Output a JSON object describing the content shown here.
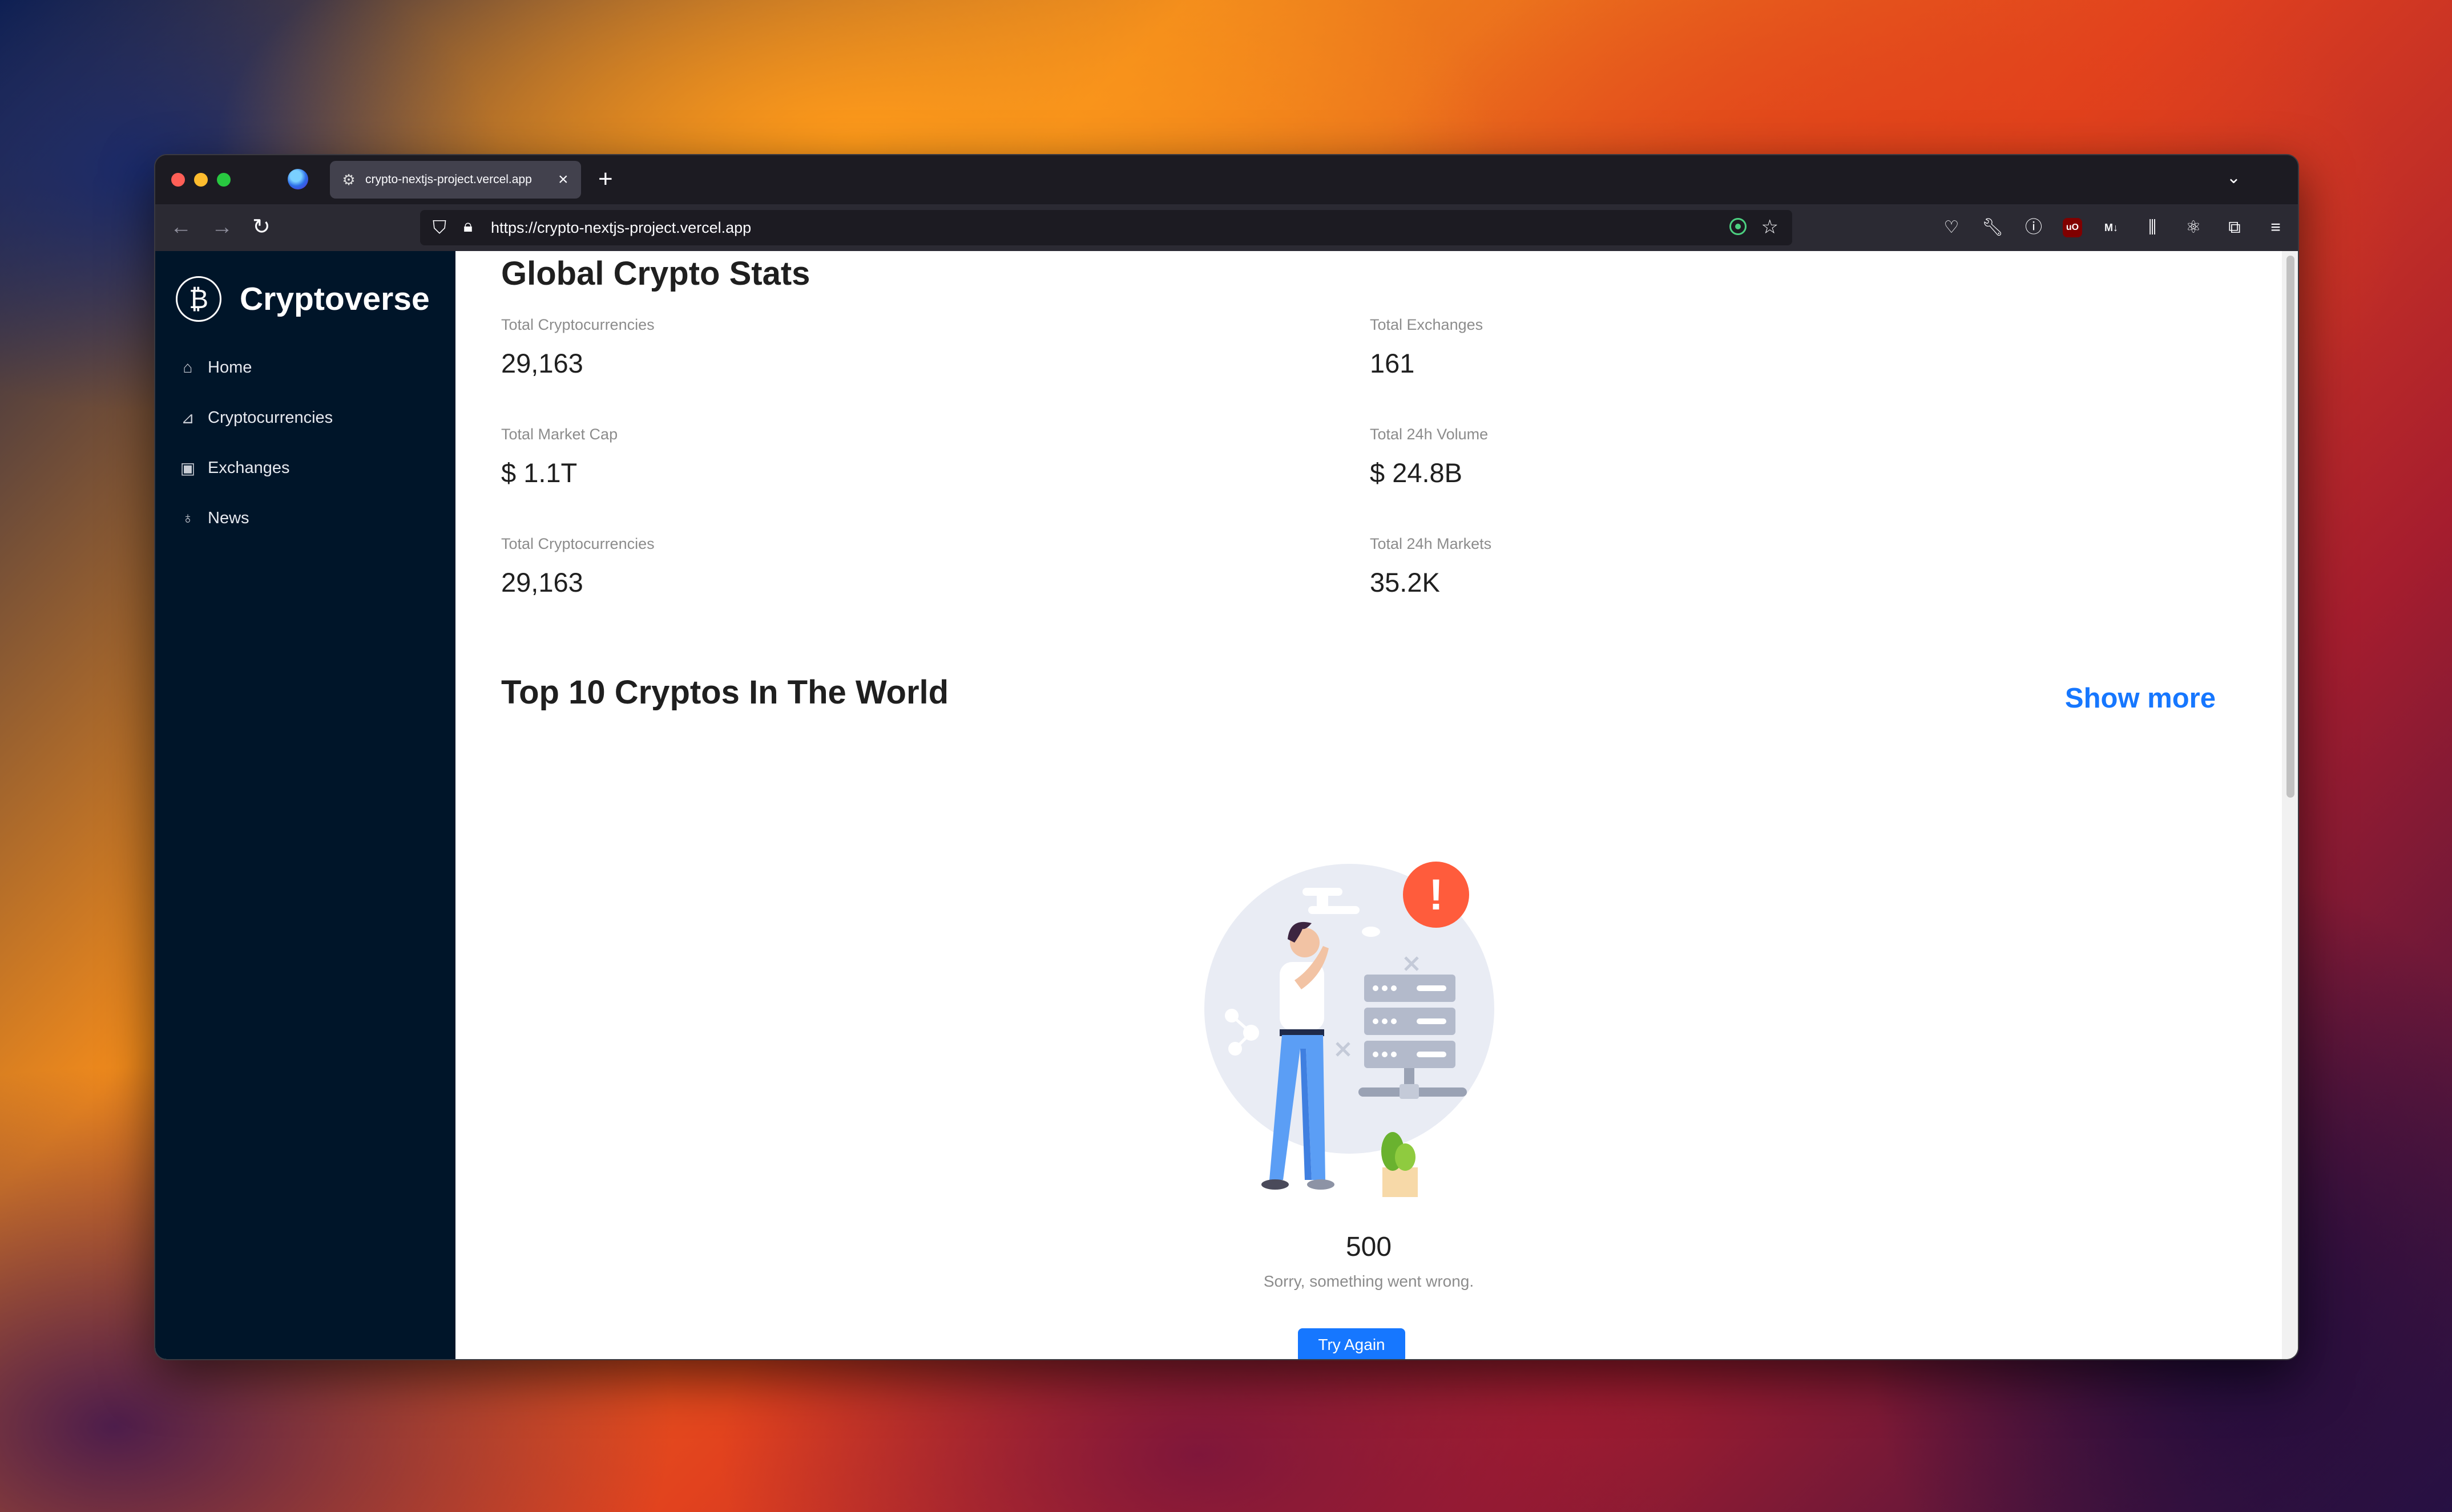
{
  "browser": {
    "tab_title": "crypto-nextjs-project.vercel.app",
    "url": "https://crypto-nextjs-project.vercel.app",
    "new_tab": "+",
    "close_tab": "×"
  },
  "sidebar": {
    "brand": "Cryptoverse",
    "items": [
      {
        "label": "Home",
        "icon": "home-icon"
      },
      {
        "label": "Cryptocurrencies",
        "icon": "fund-icon"
      },
      {
        "label": "Exchanges",
        "icon": "money-collect-icon"
      },
      {
        "label": "News",
        "icon": "bulb-icon"
      }
    ]
  },
  "stats": {
    "heading": "Global Crypto Stats",
    "items": [
      {
        "label": "Total Cryptocurrencies",
        "value": "29,163"
      },
      {
        "label": "Total Exchanges",
        "value": "161"
      },
      {
        "label": "Total Market Cap",
        "value": "$ 1.1T"
      },
      {
        "label": "Total 24h Volume",
        "value": "$ 24.8B"
      },
      {
        "label": "Total Cryptocurrencies",
        "value": "29,163"
      },
      {
        "label": "Total 24h Markets",
        "value": "35.2K"
      }
    ]
  },
  "top10": {
    "heading": "Top 10 Cryptos In The World",
    "show_more": "Show more"
  },
  "error": {
    "code": "500",
    "message": "Sorry, something went wrong.",
    "button": "Try Again",
    "badge": "!"
  },
  "colors": {
    "sidebar_bg": "#001529",
    "accent": "#1677ff",
    "error_badge": "#ff5c3c"
  }
}
